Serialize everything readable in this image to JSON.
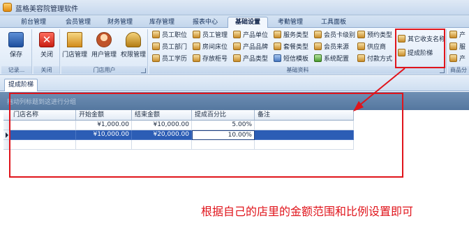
{
  "window": {
    "title": "蓝格美容院管理软件"
  },
  "tabs": [
    {
      "label": "前台管理",
      "active": false
    },
    {
      "label": "会员管理",
      "active": false
    },
    {
      "label": "财务管理",
      "active": false
    },
    {
      "label": "库存管理",
      "active": false
    },
    {
      "label": "报表中心",
      "active": false
    },
    {
      "label": "基础设置",
      "active": true
    },
    {
      "label": "考勤管理",
      "active": false
    },
    {
      "label": "工具面板",
      "active": false
    }
  ],
  "ribbon": {
    "group_records": {
      "label": "记录...",
      "save": "保存"
    },
    "group_close": {
      "label": "关闭",
      "close": "关闭"
    },
    "group_store_users": {
      "label": "门店用户",
      "store_manage": "门店管理",
      "user_manage": "用户管理",
      "permission_manage": "权限管理"
    },
    "group_basic": {
      "label": "基础资料",
      "col1": [
        "员工职位",
        "员工部门",
        "员工学历"
      ],
      "col2": [
        "员工管理",
        "房间床位",
        "存放柜号"
      ],
      "col3": [
        "产品单位",
        "产品品牌",
        "产品类型"
      ],
      "col4": [
        "服务类型",
        "套餐类型",
        "短信模板"
      ],
      "col5": [
        "会员卡级别",
        "会员来源",
        "系统配置"
      ],
      "col6": [
        "预约类型",
        "供应商",
        "付款方式"
      ],
      "col7": [
        "其它收支名称",
        "提成阶梯"
      ]
    },
    "group_goods": {
      "label": "商品分",
      "items": [
        "产",
        "服",
        "产"
      ]
    }
  },
  "document_tab": {
    "label": "提成阶梯"
  },
  "grid": {
    "group_hint": "拖动列标题到这进行分组",
    "columns": [
      "门店名称",
      "开始金额",
      "结束金额",
      "提成百分比",
      "备注"
    ],
    "rows": [
      {
        "store": "",
        "start": "¥1,000.00",
        "end": "¥10,000.00",
        "percent": "5.00%",
        "note": ""
      },
      {
        "store": "",
        "start": "¥10,000.00",
        "end": "¥20,000.00",
        "percent": "10.00%",
        "note": ""
      },
      {
        "store": "",
        "start": "",
        "end": "",
        "percent": "",
        "note": ""
      }
    ]
  },
  "annotation": "根据自己的店里的金额范围和比例设置即可",
  "colors": {
    "highlight_red": "#e0141b",
    "selection_blue": "#2c5db5",
    "group_bar": "#5f80a8"
  }
}
